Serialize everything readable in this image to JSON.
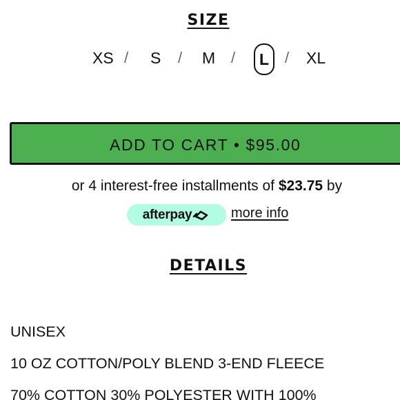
{
  "size_section": {
    "title": "SIZE",
    "options": [
      "XS",
      "S",
      "M",
      "L",
      "XL"
    ],
    "separator": "/",
    "selected": "L"
  },
  "cart": {
    "label": "ADD TO CART • $95.00",
    "button_color": "#4caf50"
  },
  "installments": {
    "prefix": "or 4 interest-free installments of",
    "amount": "$23.75",
    "suffix": "by",
    "provider_label": "afterpay",
    "provider_icon": "afterpay-arrows-icon",
    "provider_color": "#b2fce4",
    "more_info": "more info"
  },
  "details": {
    "title": "DETAILS",
    "lines": [
      "UNISEX",
      "10 OZ COTTON/POLY BLEND 3-END FLEECE",
      "70% COTTON 30% POLYESTER WITH 100%"
    ]
  }
}
